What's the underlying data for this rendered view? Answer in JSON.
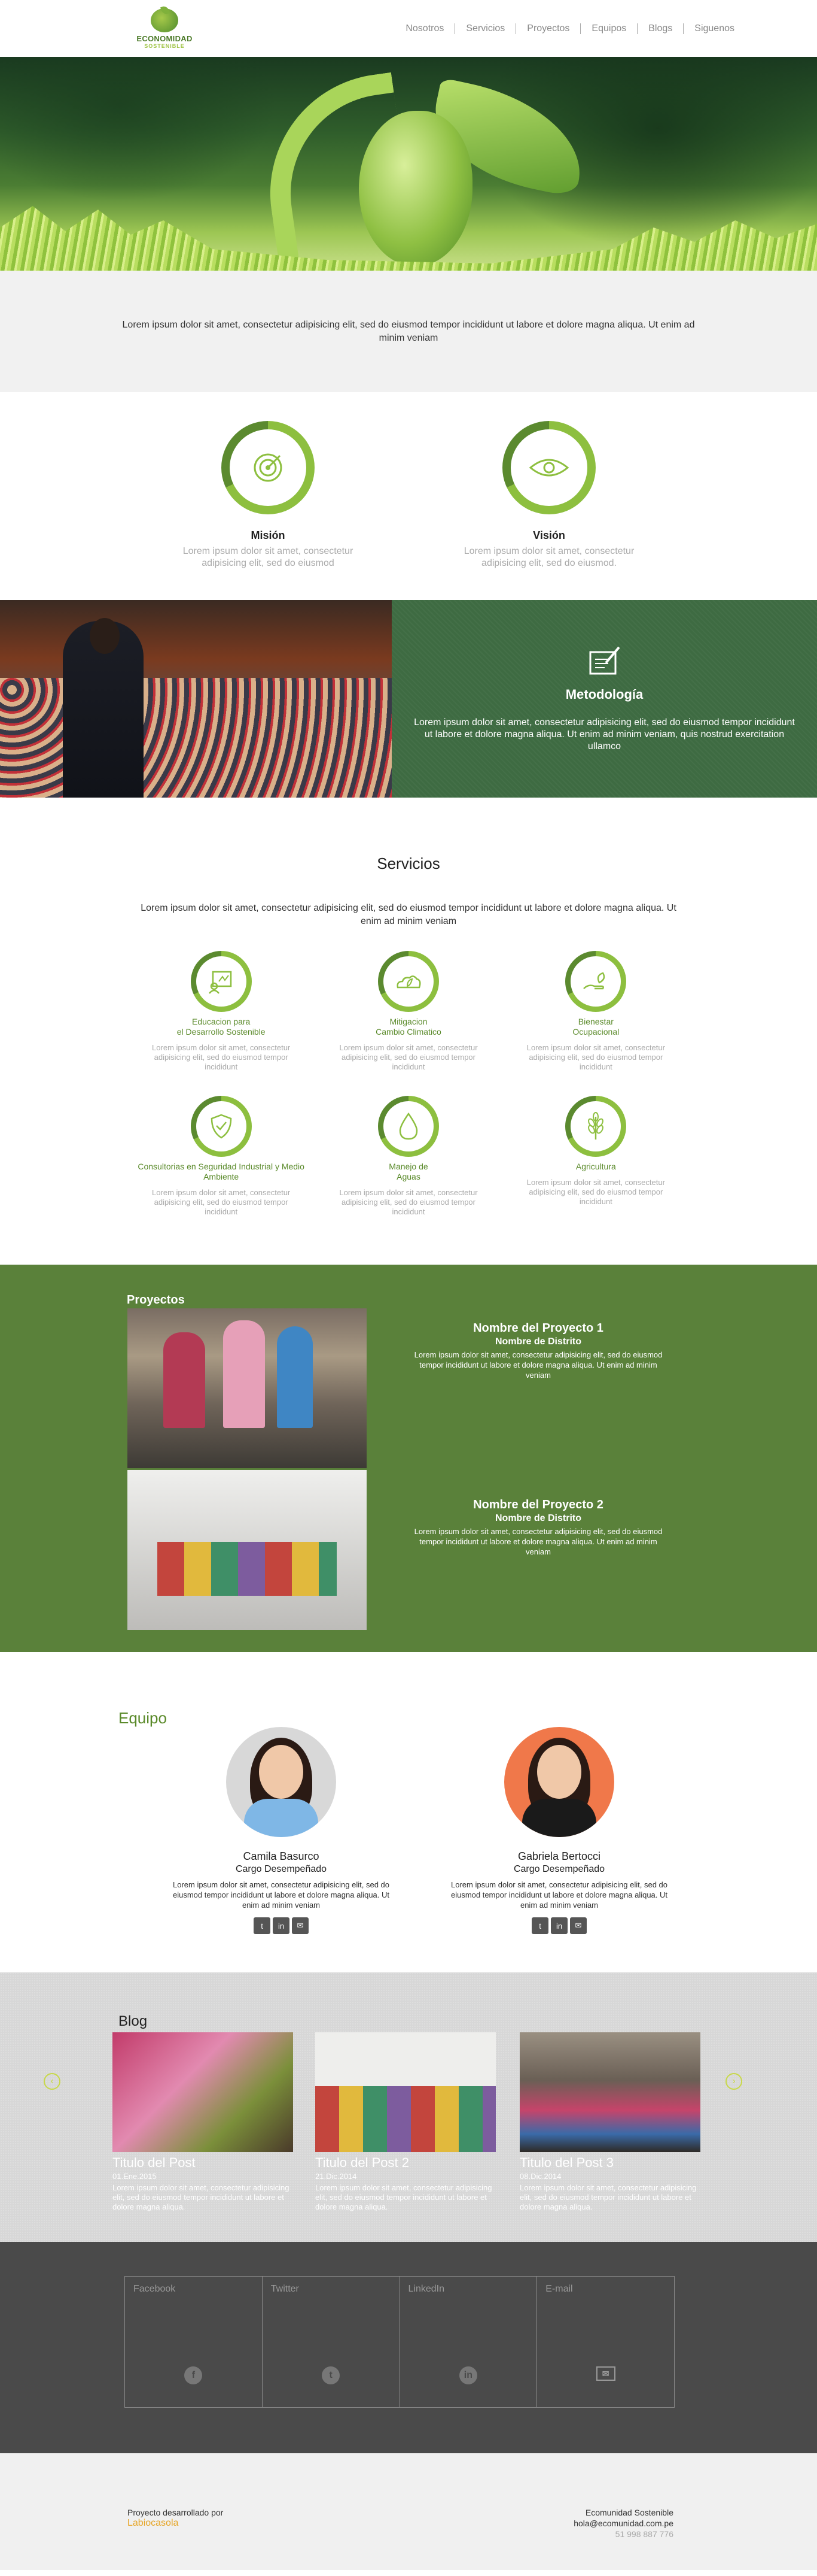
{
  "header": {
    "logo_line1": "ECONOMIDAD",
    "logo_line2": "SOSTENIBLE",
    "nav": [
      "Nosotros",
      "Servicios",
      "Proyectos",
      "Equipos",
      "Blogs",
      "Siguenos"
    ]
  },
  "intro": {
    "text": "Lorem ipsum dolor sit amet, consectetur adipisicing elit, sed do eiusmod tempor incididunt ut labore et dolore magna aliqua. Ut enim ad minim veniam"
  },
  "mision": {
    "title": "Misión",
    "text": "Lorem ipsum dolor sit amet, consectetur adipisicing elit, sed do eiusmod"
  },
  "vision": {
    "title": "Visión",
    "text": "Lorem ipsum dolor sit amet, consectetur adipisicing elit, sed do eiusmod."
  },
  "metodologia": {
    "title": "Metodología",
    "text": "Lorem ipsum dolor sit amet, consectetur adipisicing elit, sed do eiusmod tempor incididunt ut labore et dolore magna aliqua. Ut enim ad minim veniam, quis nostrud exercitation ullamco"
  },
  "servicios": {
    "title": "Servicios",
    "lead": "Lorem ipsum dolor sit amet, consectetur adipisicing elit, sed do eiusmod tempor incididunt ut labore et dolore magna aliqua. Ut enim ad minim veniam",
    "items": [
      {
        "name": "Educacion para\nel Desarrollo Sostenible",
        "icon": "education-icon",
        "text": "Lorem ipsum dolor sit amet, consectetur adipisicing elit, sed do eiusmod tempor incididunt"
      },
      {
        "name": "Mitigacion\nCambio Climatico",
        "icon": "climate-icon",
        "text": "Lorem ipsum dolor sit amet, consectetur adipisicing elit, sed do eiusmod tempor incididunt"
      },
      {
        "name": "Bienestar\nOcupacional",
        "icon": "wellbeing-icon",
        "text": "Lorem ipsum dolor sit amet, consectetur adipisicing elit, sed do eiusmod tempor incididunt"
      },
      {
        "name": "Consultorias en Seguridad Industrial y Medio\nAmbiente",
        "icon": "shield-icon",
        "text": "Lorem ipsum dolor sit amet, consectetur adipisicing elit, sed do eiusmod tempor incididunt"
      },
      {
        "name": "Manejo de\nAguas",
        "icon": "water-drop-icon",
        "text": "Lorem ipsum dolor sit amet, consectetur adipisicing elit, sed do eiusmod tempor incididunt"
      },
      {
        "name": "Agricultura",
        "icon": "wheat-icon",
        "text": "Lorem ipsum dolor sit amet, consectetur adipisicing elit, sed do eiusmod tempor incididunt"
      }
    ]
  },
  "proyectos": {
    "title": "Proyectos",
    "items": [
      {
        "name": "Nombre del Proyecto 1",
        "district": "Nombre de Distrito",
        "text": "Lorem ipsum dolor sit amet, consectetur adipisicing elit, sed do eiusmod tempor incididunt ut labore et dolore magna aliqua. Ut enim ad minim veniam"
      },
      {
        "name": "Nombre del Proyecto 2",
        "district": "Nombre de Distrito",
        "text": "Lorem ipsum dolor sit amet, consectetur adipisicing elit, sed do eiusmod tempor incididunt ut labore et dolore magna aliqua. Ut enim ad minim veniam"
      }
    ]
  },
  "equipo": {
    "title": "Equipo",
    "members": [
      {
        "name": "Camila Basurco",
        "role": "Cargo Desempeñado",
        "text": "Lorem ipsum dolor sit amet, consectetur adipisicing elit, sed do eiusmod tempor incididunt ut labore et dolore magna aliqua. Ut enim ad minim veniam"
      },
      {
        "name": "Gabriela Bertocci",
        "role": "Cargo Desempeñado",
        "text": "Lorem ipsum dolor sit amet, consectetur adipisicing elit, sed do eiusmod tempor incididunt ut labore et dolore magna aliqua. Ut enim ad minim veniam"
      }
    ],
    "social": {
      "twitter": "t",
      "linkedin": "in",
      "email": "✉"
    }
  },
  "blog": {
    "title": "Blog",
    "posts": [
      {
        "title": "Titulo del Post",
        "date": "01.Ene.2015",
        "text": "Lorem ipsum dolor sit amet, consectetur adipisicing elit, sed do eiusmod tempor incididunt ut labore et dolore magna aliqua."
      },
      {
        "title": "Titulo del Post 2",
        "date": "21.Dic.2014",
        "text": "Lorem ipsum dolor sit amet, consectetur adipisicing elit, sed do eiusmod tempor incididunt ut labore et dolore magna aliqua."
      },
      {
        "title": "Titulo del Post 3",
        "date": "08.Dic.2014",
        "text": "Lorem ipsum dolor sit amet, consectetur adipisicing elit, sed do eiusmod tempor incididunt ut labore et dolore magna aliqua."
      }
    ],
    "prev": "‹",
    "next": "›"
  },
  "contacto": {
    "cells": [
      {
        "label": "Facebook",
        "glyph": "f"
      },
      {
        "label": "Twitter",
        "glyph": "t"
      },
      {
        "label": "LinkedIn",
        "glyph": "in"
      },
      {
        "label": "E-mail",
        "glyph": "✉"
      }
    ]
  },
  "footer": {
    "credit": "Proyecto desarrollado por",
    "brand": "Labiocasola",
    "org": "Ecomunidad Sostenible",
    "email": "hola@ecomunidad.com.pe",
    "phone": "51 998 887 776"
  },
  "colors": {
    "green": "#5a813a",
    "accent": "#8dbf3f",
    "dark": "#4a4a4a",
    "orange": "#e6a423"
  }
}
